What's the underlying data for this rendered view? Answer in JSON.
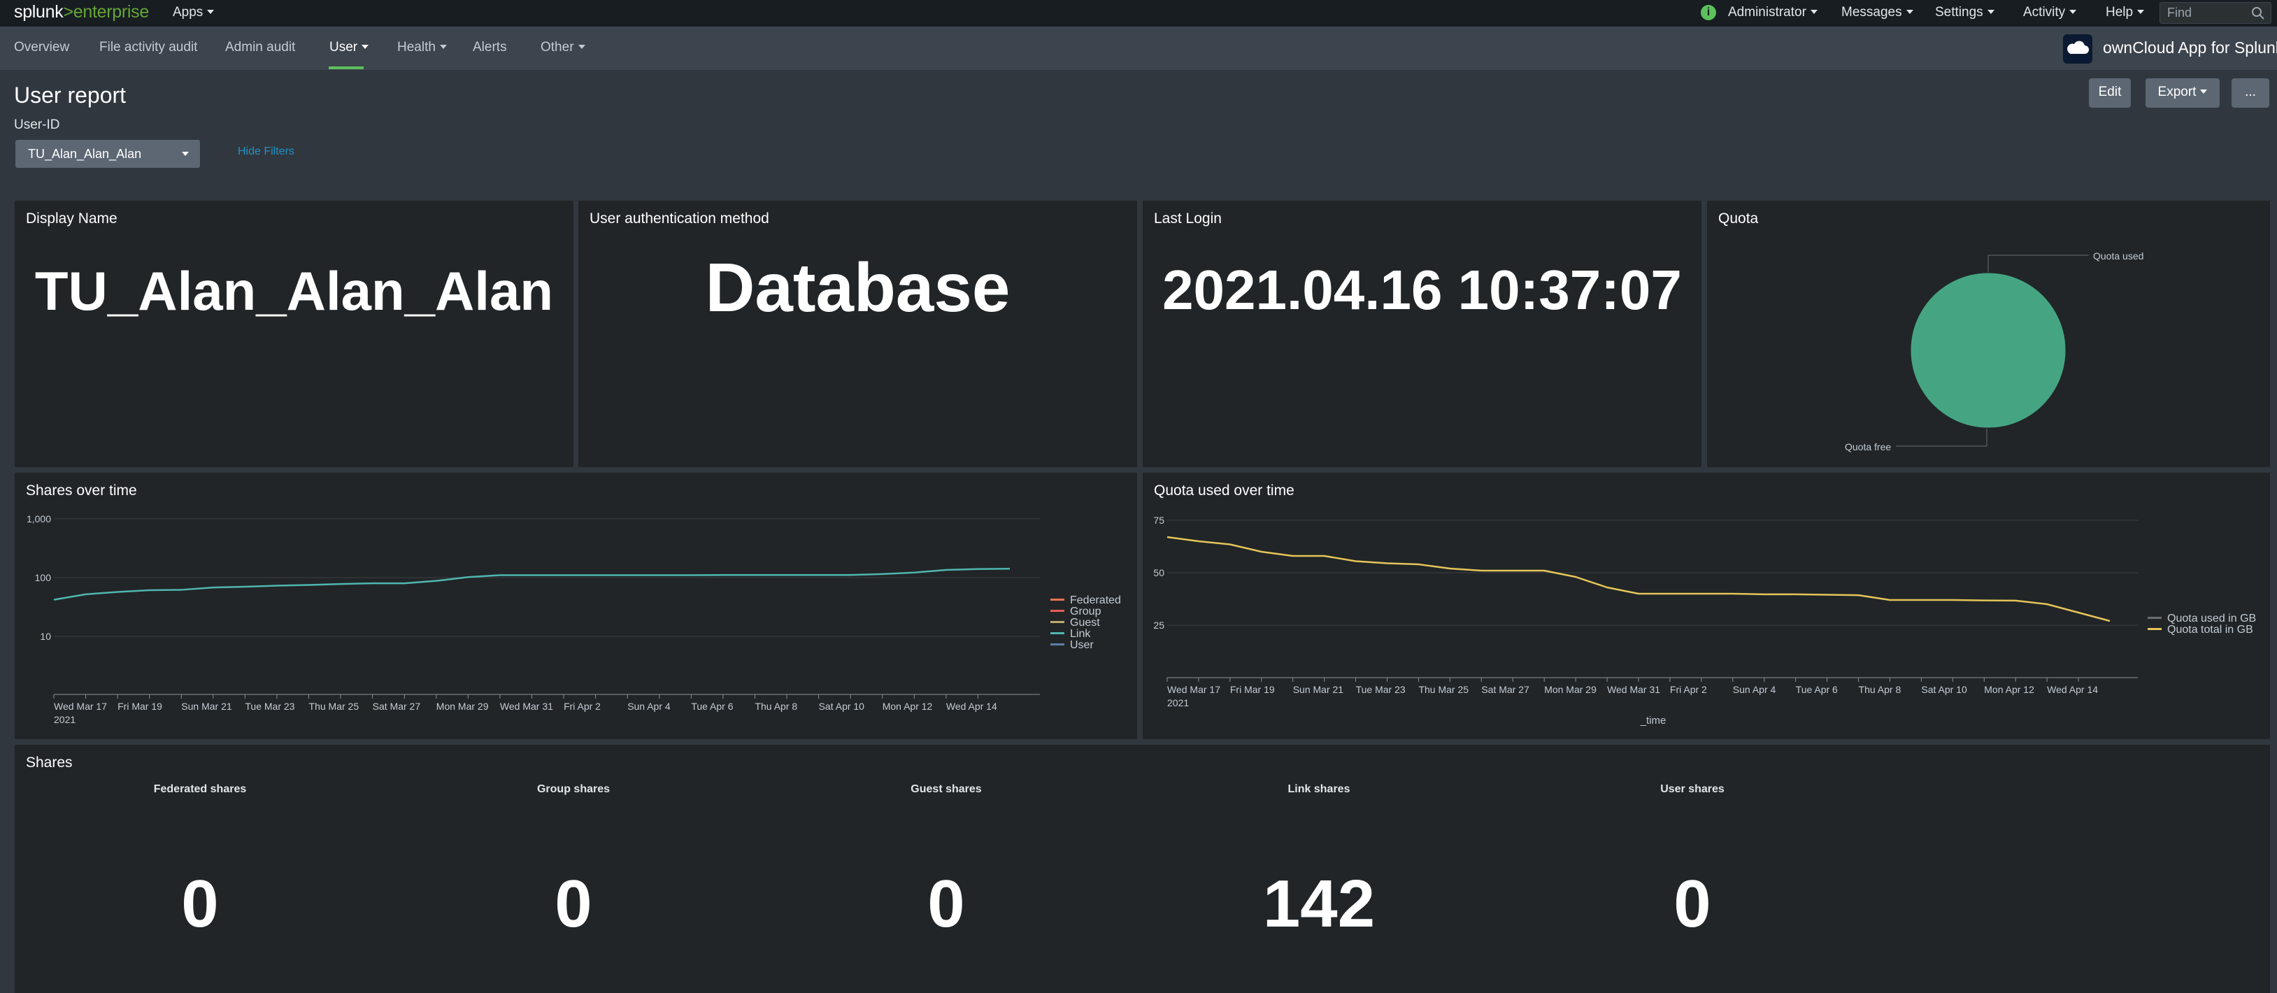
{
  "topbar": {
    "logo_a": "splunk",
    "logo_b": ">",
    "logo_c": "enterprise",
    "apps": "Apps",
    "administrator": "Administrator",
    "messages": "Messages",
    "settings": "Settings",
    "activity": "Activity",
    "help": "Help",
    "find_placeholder": "Find",
    "info": "i"
  },
  "appbar": {
    "tabs": [
      {
        "label": "Overview"
      },
      {
        "label": "File activity audit"
      },
      {
        "label": "Admin audit"
      },
      {
        "label": "User"
      },
      {
        "label": "Health"
      },
      {
        "label": "Alerts"
      },
      {
        "label": "Other"
      }
    ],
    "app_title": "ownCloud App for Splunk"
  },
  "dashboard": {
    "title": "User report",
    "edit": "Edit",
    "export": "Export",
    "more": "...",
    "filter_label": "User-ID",
    "filter_value": "TU_Alan_Alan_Alan",
    "hide_filters": "Hide Filters"
  },
  "panels": {
    "display_name": {
      "title": "Display Name",
      "value": "TU_Alan_Alan_Alan"
    },
    "auth_method": {
      "title": "User authentication method",
      "value": "Database"
    },
    "last_login": {
      "title": "Last Login",
      "value": "2021.04.16 10:37:07"
    },
    "quota": {
      "title": "Quota",
      "used_label": "Quota used",
      "free_label": "Quota free"
    },
    "shares_over_time": {
      "title": "Shares over time"
    },
    "quota_over_time": {
      "title": "Quota used over time"
    },
    "shares": {
      "title": "Shares",
      "items": [
        {
          "label": "Federated shares",
          "value": "0"
        },
        {
          "label": "Group shares",
          "value": "0"
        },
        {
          "label": "Guest shares",
          "value": "0"
        },
        {
          "label": "Link shares",
          "value": "142"
        },
        {
          "label": "User shares",
          "value": "0"
        }
      ]
    }
  },
  "colors": {
    "accent_green": "#5cc05c",
    "link_teal": "#4fb6b0",
    "quota_yellow": "#e5c45a",
    "pie_green": "#45a582",
    "federated": "#e8734f",
    "group": "#e85c55",
    "guest": "#c0a96b",
    "user": "#5e7fa8",
    "quota_used": "#6a6d70"
  },
  "chart_data": [
    {
      "type": "pie",
      "title": "Quota",
      "slices": [
        {
          "label": "Quota used",
          "value": 0.1
        },
        {
          "label": "Quota free",
          "value": 99.9
        }
      ]
    },
    {
      "type": "line",
      "title": "Shares over time",
      "yscale": "log",
      "ylim": [
        1,
        1000
      ],
      "yticks": [
        "10",
        "100",
        "1,000"
      ],
      "xticks": [
        "Wed Mar 17\n2021",
        "Fri Mar 19",
        "Sun Mar 21",
        "Tue Mar 23",
        "Thu Mar 25",
        "Sat Mar 27",
        "Mon Mar 29",
        "Wed Mar 31",
        "Fri Apr 2",
        "Sun Apr 4",
        "Tue Apr 6",
        "Thu Apr 8",
        "Sat Apr 10",
        "Mon Apr 12",
        "Wed Apr 14"
      ],
      "x": [
        "2021-03-17",
        "2021-03-18",
        "2021-03-19",
        "2021-03-20",
        "2021-03-21",
        "2021-03-22",
        "2021-03-23",
        "2021-03-24",
        "2021-03-25",
        "2021-03-26",
        "2021-03-27",
        "2021-03-28",
        "2021-03-29",
        "2021-03-30",
        "2021-03-31",
        "2021-04-01",
        "2021-04-02",
        "2021-04-03",
        "2021-04-04",
        "2021-04-05",
        "2021-04-06",
        "2021-04-07",
        "2021-04-08",
        "2021-04-09",
        "2021-04-10",
        "2021-04-11",
        "2021-04-12",
        "2021-04-13",
        "2021-04-14",
        "2021-04-15",
        "2021-04-16"
      ],
      "legend": [
        "Federated",
        "Group",
        "Guest",
        "Link",
        "User"
      ],
      "legend_position": "right",
      "series": [
        {
          "name": "Link",
          "values": [
            42,
            52,
            57,
            61,
            62,
            68,
            70,
            73,
            75,
            78,
            80,
            80,
            88,
            102,
            110,
            110,
            110,
            110,
            110,
            110,
            110,
            111,
            111,
            111,
            111,
            111,
            115,
            122,
            135,
            140,
            142
          ]
        }
      ]
    },
    {
      "type": "line",
      "title": "Quota used over time",
      "xlabel": "_time",
      "ylim": [
        0,
        80
      ],
      "yticks": [
        "25",
        "50",
        "75"
      ],
      "xticks": [
        "Wed Mar 17\n2021",
        "Fri Mar 19",
        "Sun Mar 21",
        "Tue Mar 23",
        "Thu Mar 25",
        "Sat Mar 27",
        "Mon Mar 29",
        "Wed Mar 31",
        "Fri Apr 2",
        "Sun Apr 4",
        "Tue Apr 6",
        "Thu Apr 8",
        "Sat Apr 10",
        "Mon Apr 12",
        "Wed Apr 14"
      ],
      "x": [
        "2021-03-17",
        "2021-03-18",
        "2021-03-19",
        "2021-03-20",
        "2021-03-21",
        "2021-03-22",
        "2021-03-23",
        "2021-03-24",
        "2021-03-25",
        "2021-03-26",
        "2021-03-27",
        "2021-03-28",
        "2021-03-29",
        "2021-03-30",
        "2021-03-31",
        "2021-04-01",
        "2021-04-02",
        "2021-04-03",
        "2021-04-04",
        "2021-04-05",
        "2021-04-06",
        "2021-04-07",
        "2021-04-08",
        "2021-04-09",
        "2021-04-10",
        "2021-04-11",
        "2021-04-12",
        "2021-04-13",
        "2021-04-14",
        "2021-04-15",
        "2021-04-16"
      ],
      "legend": [
        "Quota used in GB",
        "Quota total in GB"
      ],
      "legend_position": "right",
      "series": [
        {
          "name": "Quota total in GB",
          "values": [
            67,
            65,
            63.5,
            60,
            58,
            58,
            55.5,
            54.5,
            54,
            52,
            51,
            51,
            51,
            48,
            43,
            40,
            40,
            40,
            40,
            39.7,
            39.7,
            39.5,
            39.3,
            37,
            37,
            37,
            36.8,
            36.7,
            35,
            31,
            27
          ]
        }
      ]
    }
  ]
}
